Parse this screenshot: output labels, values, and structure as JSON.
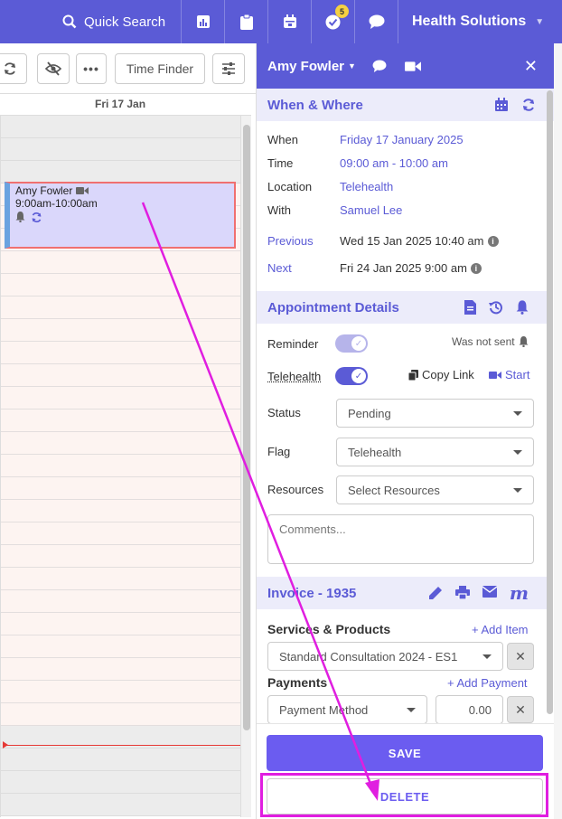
{
  "topbar": {
    "search_label": "Quick Search",
    "notifications_count": "5",
    "org_name": "Health Solutions",
    "icons": [
      "search-icon",
      "chart-icon",
      "clipboard-icon",
      "calendar-icon",
      "check-badge-icon",
      "chat-icon",
      "chevron-down-icon"
    ]
  },
  "toolbar": {
    "time_finder_label": "Time Finder"
  },
  "calendar": {
    "day_label": "Fri 17 Jan",
    "appointment": {
      "name": "Amy Fowler",
      "time": "9:00am-10:00am"
    }
  },
  "panel": {
    "patient_name": "Amy Fowler",
    "when_where": {
      "title": "When & Where",
      "when_label": "When",
      "when_value": "Friday 17 January 2025",
      "time_label": "Time",
      "time_value": "09:00 am - 10:00 am",
      "location_label": "Location",
      "location_value": "Telehealth",
      "with_label": "With",
      "with_value": "Samuel Lee",
      "previous_label": "Previous",
      "previous_value": "Wed 15 Jan 2025 10:40 am",
      "next_label": "Next",
      "next_value": "Fri 24 Jan 2025 9:00 am"
    },
    "details": {
      "title": "Appointment Details",
      "reminder_label": "Reminder",
      "reminder_status": "Was not sent",
      "reminder_on": 0.5,
      "telehealth_label": "Telehealth",
      "telehealth_on": 1,
      "copy_link_label": "Copy Link",
      "start_label": "Start",
      "status_label": "Status",
      "status_value": "Pending",
      "flag_label": "Flag",
      "flag_value": "Telehealth",
      "resources_label": "Resources",
      "resources_placeholder": "Select Resources",
      "comments_placeholder": "Comments..."
    },
    "invoice": {
      "title": "Invoice - 1935",
      "services_label": "Services & Products",
      "add_item_label": "+ Add Item",
      "service_value": "Standard Consultation 2024 - ES1",
      "payments_label": "Payments",
      "add_payment_label": "+ Add Payment",
      "payment_method_placeholder": "Payment Method",
      "payment_amount": "0.00"
    },
    "save_label": "SAVE",
    "delete_label": "DELETE"
  },
  "colors": {
    "brand": "#5b5bd6",
    "button": "#6b5cf0",
    "annotation": "#e01ee0",
    "appointment_bg": "#dad7fb"
  }
}
